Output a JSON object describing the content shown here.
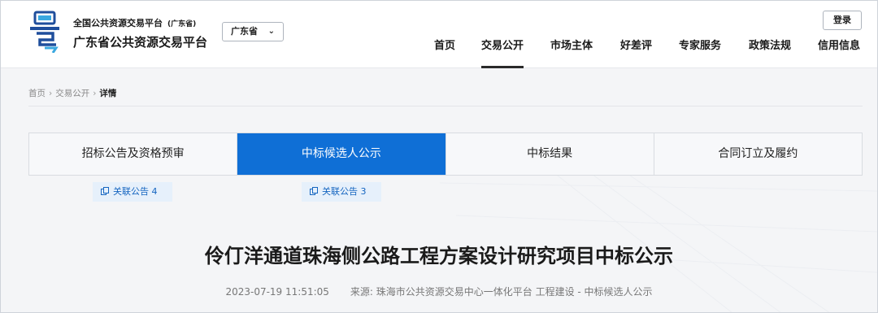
{
  "header": {
    "brand_small": "全国公共资源交易平台",
    "brand_region": "(广东省)",
    "brand_big": "广东省公共资源交易平台",
    "region_select": "广东省",
    "login": "登录",
    "nav": [
      "首页",
      "交易公开",
      "市场主体",
      "好差评",
      "专家服务",
      "政策法规",
      "信用信息"
    ],
    "active_nav": "交易公开"
  },
  "breadcrumb": {
    "home": "首页",
    "section": "交易公开",
    "current": "详情"
  },
  "tabs": [
    "招标公告及资格预审",
    "中标候选人公示",
    "中标结果",
    "合同订立及履约"
  ],
  "active_tab": "中标候选人公示",
  "related": [
    {
      "label": "关联公告 4"
    },
    {
      "label": "关联公告 3"
    }
  ],
  "article": {
    "title": "伶仃洋通道珠海侧公路工程方案设计研究项目中标公示",
    "datetime": "2023-07-19 11:51:05",
    "source": "来源: 珠海市公共资源交易中心一体化平台 工程建设 - 中标候选人公示"
  },
  "colors": {
    "accent": "#0f6fd6",
    "related_bg": "#e6f0fb"
  }
}
